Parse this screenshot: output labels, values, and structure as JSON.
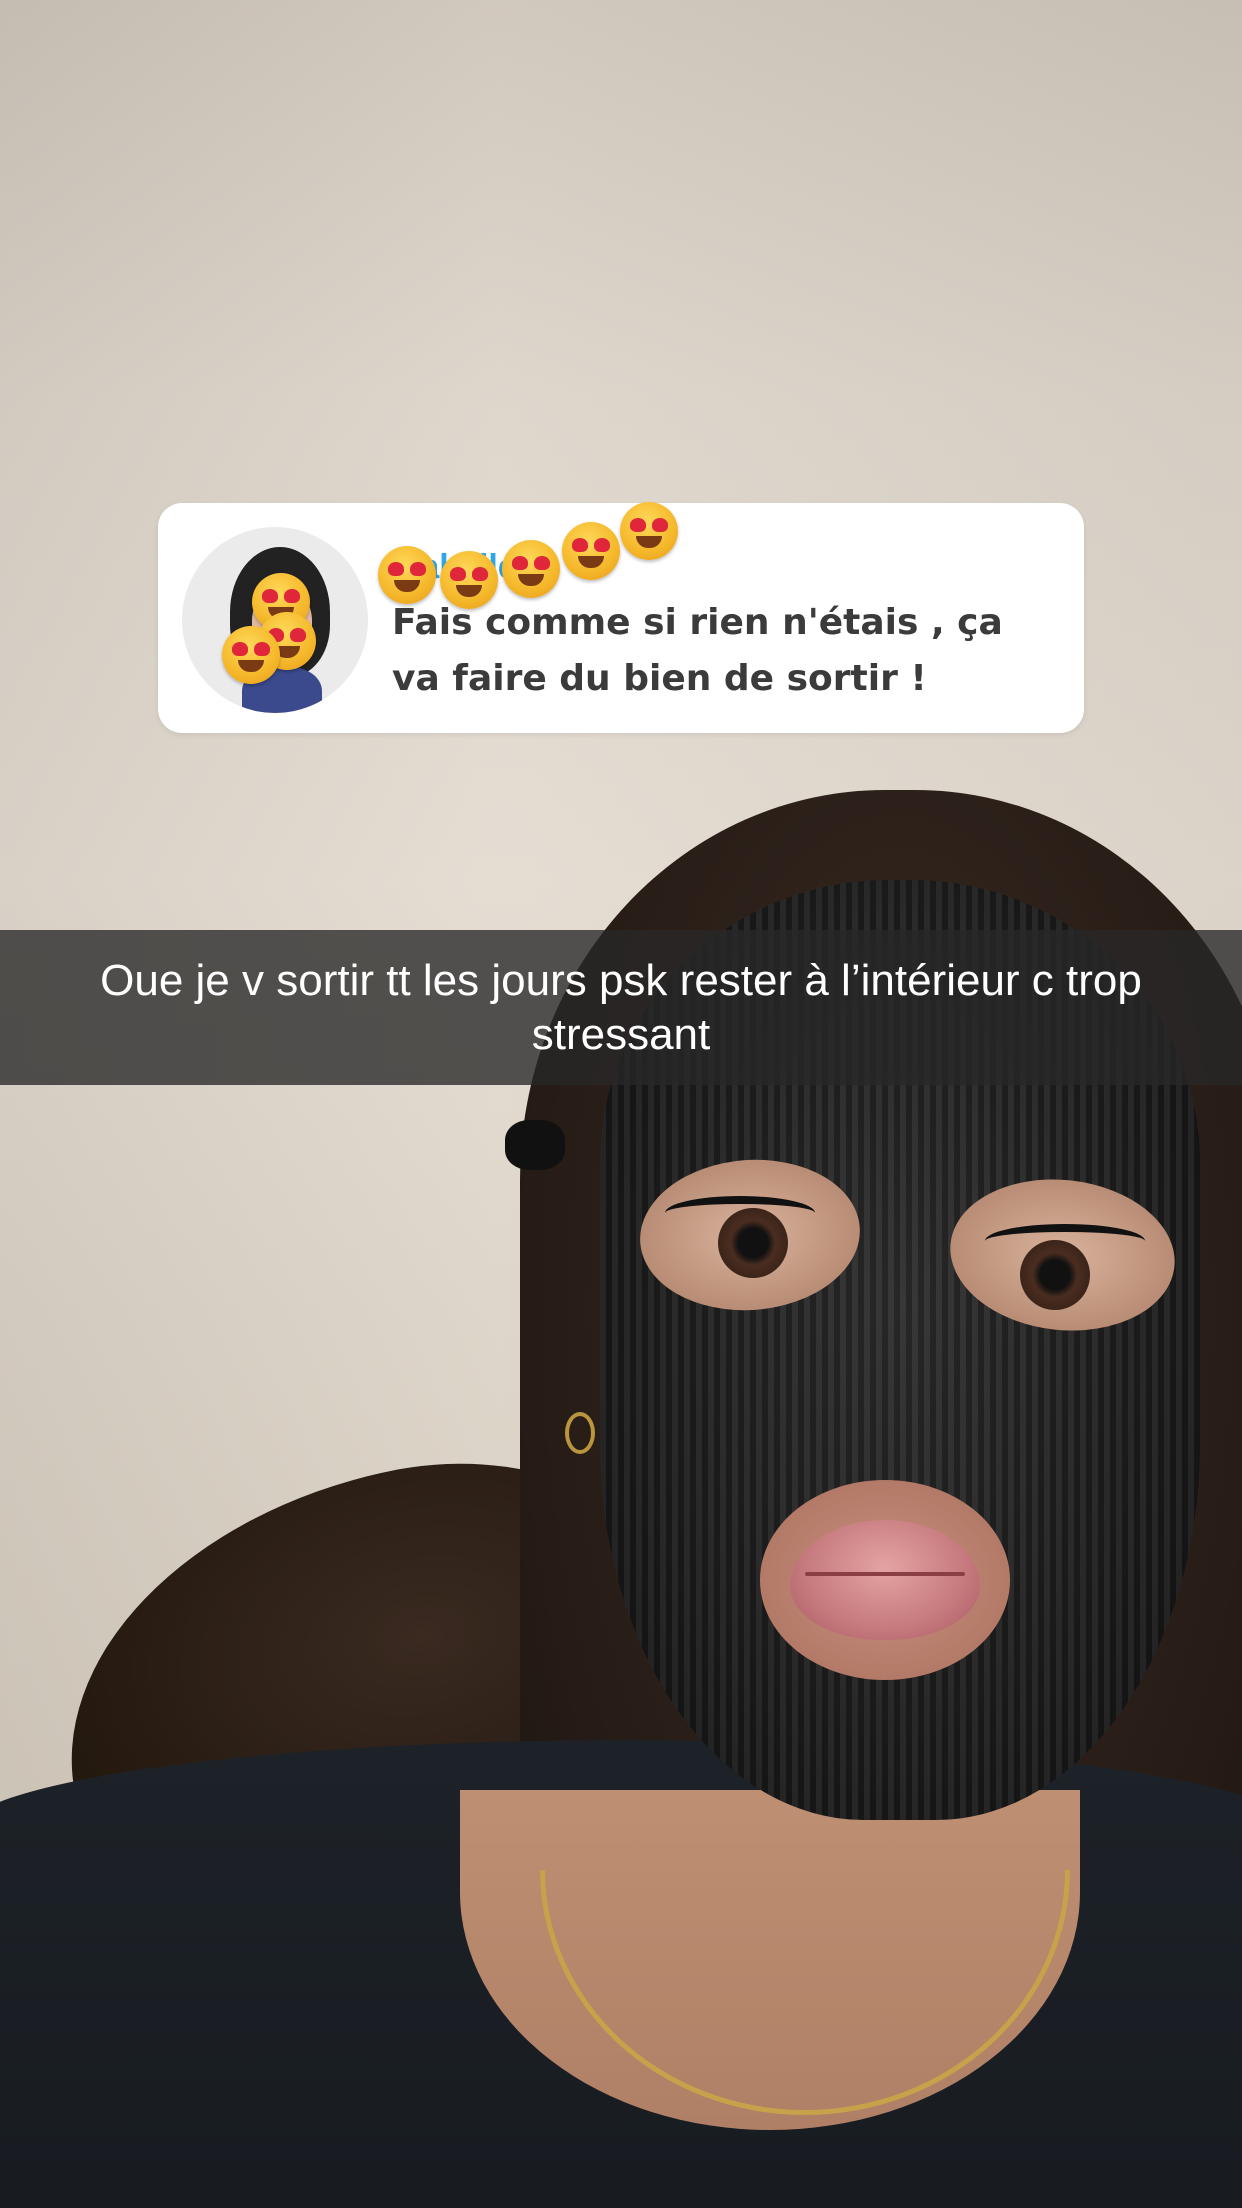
{
  "reply": {
    "author_name": "Mabelle",
    "message": "Fais comme si rien n'étais , ça va faire du bien de sortir !",
    "reaction_emoji": "heart-eyes"
  },
  "caption": {
    "text": "Oue je v sortir tt les jours psk rester à l’intérieur c trop stressant"
  },
  "colors": {
    "card_background": "#ffffff",
    "reply_name": "#2ea6ea",
    "reply_text": "#3b3b3b",
    "caption_bar": "#282828",
    "caption_text": "#ffffff"
  }
}
